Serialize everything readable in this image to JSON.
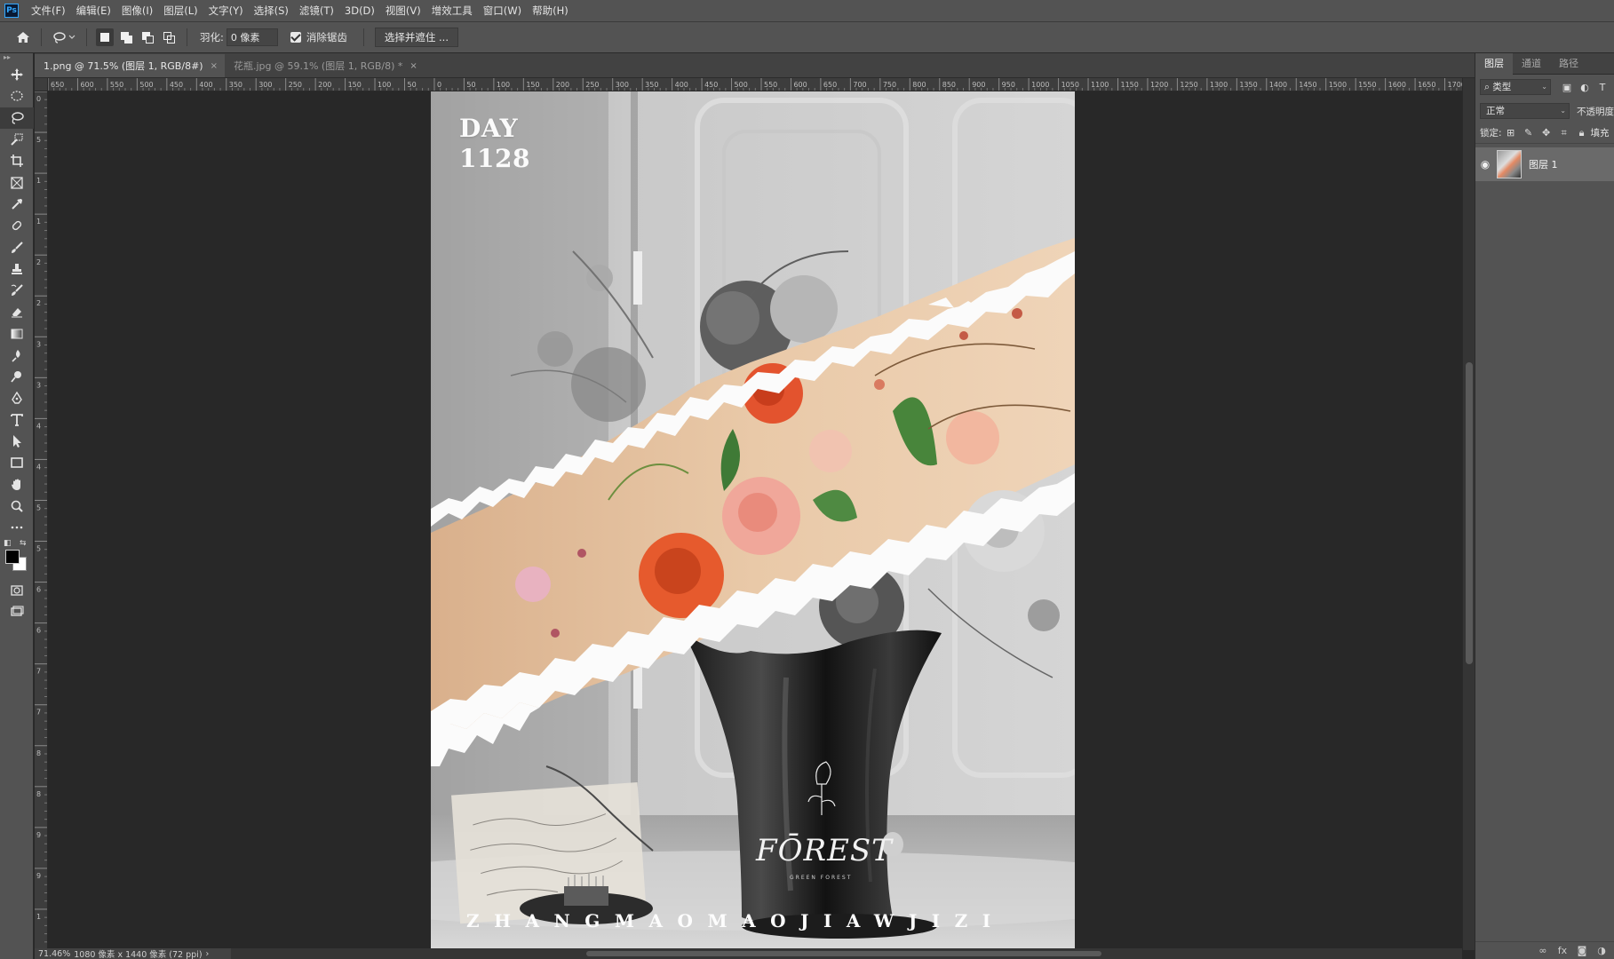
{
  "app": {
    "logo": "Ps"
  },
  "menu": [
    "文件(F)",
    "编辑(E)",
    "图像(I)",
    "图层(L)",
    "文字(Y)",
    "选择(S)",
    "滤镜(T)",
    "3D(D)",
    "视图(V)",
    "增效工具",
    "窗口(W)",
    "帮助(H)"
  ],
  "options": {
    "feather_label": "羽化:",
    "feather_value": "0 像素",
    "antialias_label": "消除锯齿",
    "select_mask_label": "选择并遮住 ..."
  },
  "tabs": [
    {
      "label": "1.png @ 71.5% (图层 1, RGB/8#)",
      "close": "×"
    },
    {
      "label": "花瓶.jpg @ 59.1% (图层 1, RGB/8) *",
      "close": "×"
    }
  ],
  "ruler_top_labels": [
    "650",
    "600",
    "550",
    "500",
    "450",
    "400",
    "350",
    "300",
    "250",
    "200",
    "150",
    "100",
    "50",
    "0",
    "50",
    "100",
    "150",
    "200",
    "250",
    "300",
    "350",
    "400",
    "450",
    "500",
    "550",
    "600",
    "650",
    "700",
    "750",
    "800",
    "850",
    "900",
    "950",
    "1000",
    "1050",
    "1100",
    "1150",
    "1200",
    "1250",
    "1300",
    "1350",
    "1400",
    "1450",
    "1500",
    "1550",
    "1600",
    "1650",
    "1700"
  ],
  "ruler_left_labels": [
    "0",
    "5",
    "1",
    "1",
    "2",
    "2",
    "3",
    "3",
    "4",
    "4",
    "5",
    "5",
    "6",
    "6",
    "7",
    "7",
    "8",
    "8",
    "9",
    "9",
    "1"
  ],
  "canvas": {
    "day_title": "DAY",
    "day_number": "1128",
    "logo_text": "FŌREST",
    "logo_subtext": "GREEN FOREST",
    "footer_letters": "ZHANGMAOMAOJIAWJIZI"
  },
  "status": {
    "zoom": "71.46%",
    "doc_info": "1080 像素 x 1440 像素 (72 ppi)",
    "arrow": "›"
  },
  "panel": {
    "tabs": [
      "图层",
      "通道",
      "路径"
    ],
    "filter_label": "类型",
    "blend_mode": "正常",
    "opacity_label": "不透明度",
    "lock_label": "锁定:",
    "fill_label": "填充",
    "layer_name": "图层 1"
  },
  "colors": {
    "ui_dark": "#535353",
    "canvas_bg": "#282828",
    "accent": "#31a8ff",
    "rose_orange": "#e3532e",
    "peach_bg": "#e9c9a8"
  }
}
